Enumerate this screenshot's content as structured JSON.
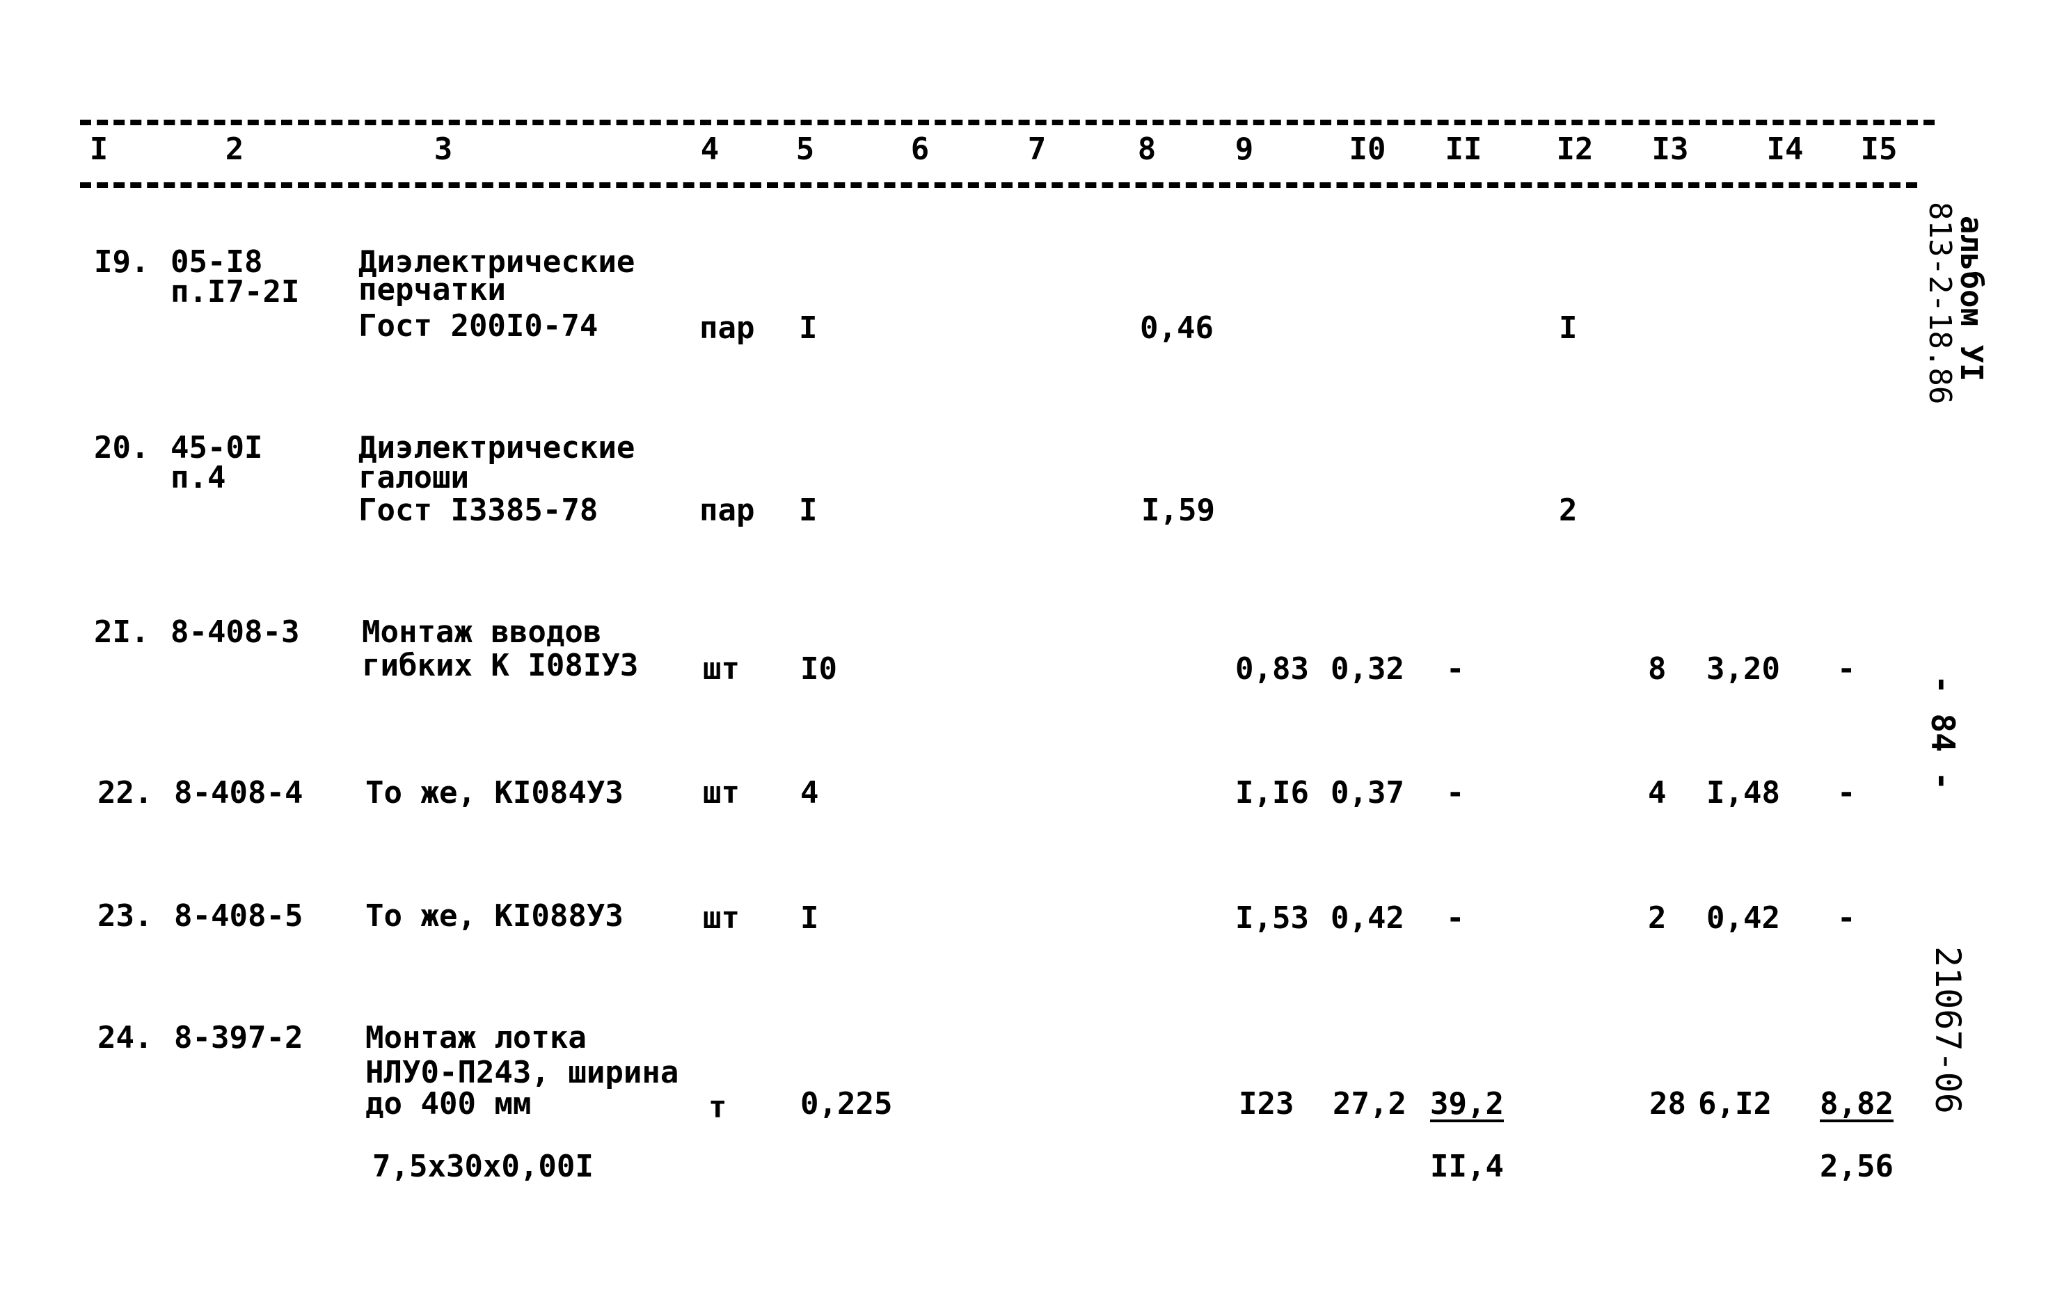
{
  "header": {
    "columns": [
      "I",
      "2",
      "3",
      "4",
      "5",
      "6",
      "7",
      "8",
      "9",
      "I0",
      "II",
      "I2",
      "I3",
      "I4",
      "I5"
    ]
  },
  "rows": [
    {
      "num": "I9.",
      "code": [
        "05-I8",
        "п.I7-2I"
      ],
      "desc": [
        "Диэлектрические",
        "перчатки",
        "Гост 200I0-74"
      ],
      "unit": "пар",
      "qty": "I",
      "c8": "0,46",
      "c12": "I"
    },
    {
      "num": "20.",
      "code": [
        "45-0I",
        "п.4"
      ],
      "desc": [
        "Диэлектрические",
        "галоши",
        "Гост I3385-78"
      ],
      "unit": "пар",
      "qty": "I",
      "c8": "I,59",
      "c12": "2"
    },
    {
      "num": "2I.",
      "code": [
        "8-408-3"
      ],
      "desc": [
        "Монтаж вводов",
        "гибких К I08IУ3"
      ],
      "unit": "шт",
      "qty": "I0",
      "c9": "0,83",
      "c10": "0,32",
      "c11": "-",
      "c13": "8",
      "c14": "3,20",
      "c15": "-"
    },
    {
      "num": "22.",
      "code": [
        "8-408-4"
      ],
      "desc": [
        "То же, КI084У3"
      ],
      "unit": "шт",
      "qty": "4",
      "c9": "I,I6",
      "c10": "0,37",
      "c11": "-",
      "c13": "4",
      "c14": "I,48",
      "c15": "-"
    },
    {
      "num": "23.",
      "code": [
        "8-408-5"
      ],
      "desc": [
        "То же, КI088У3"
      ],
      "unit": "шт",
      "qty": "I",
      "c9": "I,53",
      "c10": "0,42",
      "c11": "-",
      "c13": "2",
      "c14": "0,42",
      "c15": "-"
    },
    {
      "num": "24.",
      "code": [
        "8-397-2"
      ],
      "desc": [
        "Монтаж лотка",
        "НЛУ0-П243, ширина",
        "до 400 мм"
      ],
      "unit": "т",
      "qty": "0,225",
      "c9": "I23",
      "c10": "27,2",
      "c11": "39,2",
      "c13": "28",
      "c14": "6,I2",
      "c15": "8,82",
      "extra_desc": "7,5х30х0,00I",
      "extra_c11": "II,4",
      "extra_c15": "2,56"
    }
  ],
  "margin": {
    "album": "альбом УI",
    "album_code": "813-2-18.86",
    "page_number": "- 84 -",
    "doc_code": "21067-06"
  }
}
